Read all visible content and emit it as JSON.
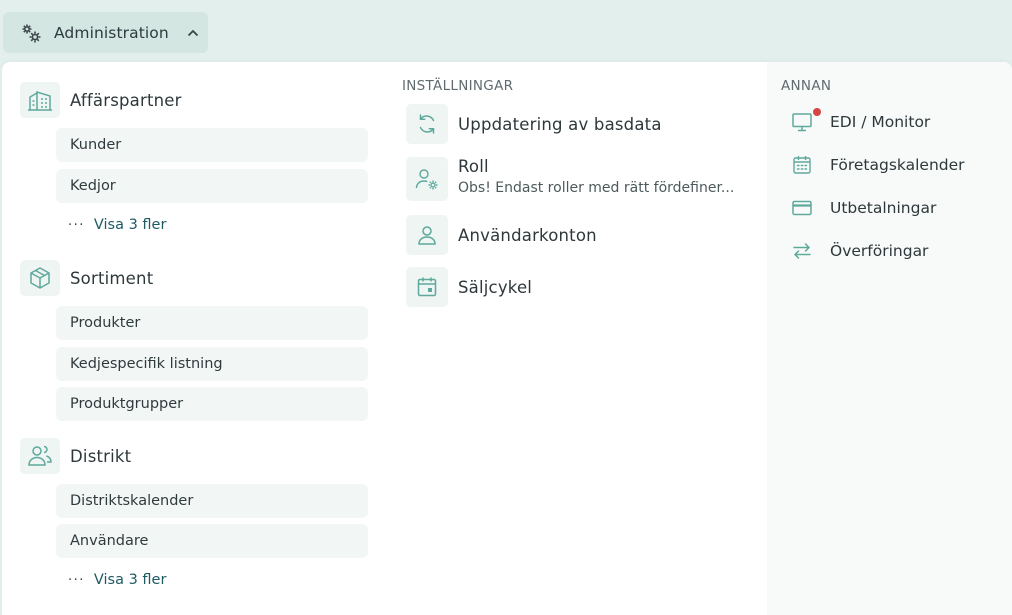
{
  "trigger": {
    "label": "Administration"
  },
  "left": {
    "sections": [
      {
        "title": "Affärspartner",
        "icon": "building-icon",
        "items": [
          "Kunder",
          "Kedjor"
        ],
        "more": "Visa 3 fler"
      },
      {
        "title": "Sortiment",
        "icon": "box-icon",
        "items": [
          "Produkter",
          "Kedjespecifik listning",
          "Produktgrupper"
        ]
      },
      {
        "title": "Distrikt",
        "icon": "users-icon",
        "items": [
          "Distriktskalender",
          "Användare"
        ],
        "more": "Visa 3 fler"
      }
    ]
  },
  "middle": {
    "heading": "INSTÄLLNINGAR",
    "items": [
      {
        "title": "Uppdatering av basdata",
        "icon": "refresh-icon"
      },
      {
        "title": "Roll",
        "desc": "Obs! Endast roller med rätt fördefiner...",
        "icon": "user-gear-icon"
      },
      {
        "title": "Användarkonton",
        "icon": "user-icon"
      },
      {
        "title": "Säljcykel",
        "icon": "calendar-day-icon"
      }
    ]
  },
  "right": {
    "heading": "ANNAN",
    "items": [
      {
        "label": "EDI / Monitor",
        "icon": "monitor-icon",
        "badge": true
      },
      {
        "label": "Företagskalender",
        "icon": "calendar-icon"
      },
      {
        "label": "Utbetalningar",
        "icon": "credit-card-icon"
      },
      {
        "label": "Överföringar",
        "icon": "transfer-icon"
      }
    ]
  },
  "colors": {
    "accent": "#5fa89c",
    "badge": "#d64545",
    "link": "#1e5a63"
  }
}
